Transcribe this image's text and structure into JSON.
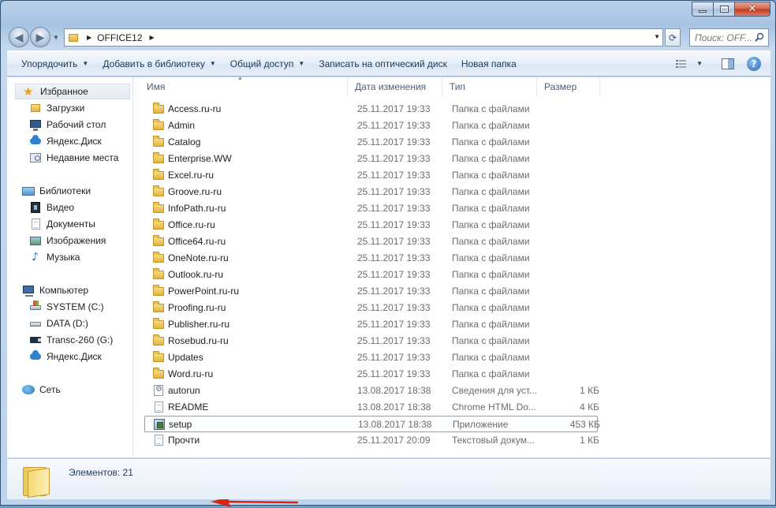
{
  "window": {
    "caption": {
      "minimize": "",
      "maximize": "",
      "close": "✕"
    }
  },
  "address": {
    "path": "OFFICE12",
    "search_placeholder": "Поиск: OFF..."
  },
  "toolbar": {
    "organize": "Упорядочить",
    "add_to_library": "Добавить в библиотеку",
    "share": "Общий доступ",
    "burn": "Записать на оптический диск",
    "new_folder": "Новая папка",
    "help": "?"
  },
  "sidebar": {
    "favorites": {
      "label": "Избранное",
      "items": [
        "Загрузки",
        "Рабочий стол",
        "Яндекс.Диск",
        "Недавние места"
      ]
    },
    "libraries": {
      "label": "Библиотеки",
      "items": [
        "Видео",
        "Документы",
        "Изображения",
        "Музыка"
      ]
    },
    "computer": {
      "label": "Компьютер",
      "items": [
        "SYSTEM (C:)",
        "DATA (D:)",
        "Transc-260 (G:)",
        "Яндекс.Диск"
      ]
    },
    "network": {
      "label": "Сеть"
    }
  },
  "columns": {
    "name": "Имя",
    "date": "Дата изменения",
    "type": "Тип",
    "size": "Размер"
  },
  "files": [
    {
      "name": "Access.ru-ru",
      "date": "25.11.2017 19:33",
      "type": "Папка с файлами",
      "size": "",
      "icon": "folder-icon"
    },
    {
      "name": "Admin",
      "date": "25.11.2017 19:33",
      "type": "Папка с файлами",
      "size": "",
      "icon": "folder-icon"
    },
    {
      "name": "Catalog",
      "date": "25.11.2017 19:33",
      "type": "Папка с файлами",
      "size": "",
      "icon": "folder-icon"
    },
    {
      "name": "Enterprise.WW",
      "date": "25.11.2017 19:33",
      "type": "Папка с файлами",
      "size": "",
      "icon": "folder-icon"
    },
    {
      "name": "Excel.ru-ru",
      "date": "25.11.2017 19:33",
      "type": "Папка с файлами",
      "size": "",
      "icon": "folder-icon"
    },
    {
      "name": "Groove.ru-ru",
      "date": "25.11.2017 19:33",
      "type": "Папка с файлами",
      "size": "",
      "icon": "folder-icon"
    },
    {
      "name": "InfoPath.ru-ru",
      "date": "25.11.2017 19:33",
      "type": "Папка с файлами",
      "size": "",
      "icon": "folder-icon"
    },
    {
      "name": "Office.ru-ru",
      "date": "25.11.2017 19:33",
      "type": "Папка с файлами",
      "size": "",
      "icon": "folder-icon"
    },
    {
      "name": "Office64.ru-ru",
      "date": "25.11.2017 19:33",
      "type": "Папка с файлами",
      "size": "",
      "icon": "folder-icon"
    },
    {
      "name": "OneNote.ru-ru",
      "date": "25.11.2017 19:33",
      "type": "Папка с файлами",
      "size": "",
      "icon": "folder-icon"
    },
    {
      "name": "Outlook.ru-ru",
      "date": "25.11.2017 19:33",
      "type": "Папка с файлами",
      "size": "",
      "icon": "folder-icon"
    },
    {
      "name": "PowerPoint.ru-ru",
      "date": "25.11.2017 19:33",
      "type": "Папка с файлами",
      "size": "",
      "icon": "folder-icon"
    },
    {
      "name": "Proofing.ru-ru",
      "date": "25.11.2017 19:33",
      "type": "Папка с файлами",
      "size": "",
      "icon": "folder-icon"
    },
    {
      "name": "Publisher.ru-ru",
      "date": "25.11.2017 19:33",
      "type": "Папка с файлами",
      "size": "",
      "icon": "folder-icon"
    },
    {
      "name": "Rosebud.ru-ru",
      "date": "25.11.2017 19:33",
      "type": "Папка с файлами",
      "size": "",
      "icon": "folder-icon"
    },
    {
      "name": "Updates",
      "date": "25.11.2017 19:33",
      "type": "Папка с файлами",
      "size": "",
      "icon": "folder-icon"
    },
    {
      "name": "Word.ru-ru",
      "date": "25.11.2017 19:33",
      "type": "Папка с файлами",
      "size": "",
      "icon": "folder-icon"
    },
    {
      "name": "autorun",
      "date": "13.08.2017 18:38",
      "type": "Сведения для уст...",
      "size": "1 КБ",
      "icon": "setup-info-icon"
    },
    {
      "name": "README",
      "date": "13.08.2017 18:38",
      "type": "Chrome HTML Do...",
      "size": "4 КБ",
      "icon": "document-icon"
    },
    {
      "name": "setup",
      "date": "13.08.2017 18:38",
      "type": "Приложение",
      "size": "453 КБ",
      "icon": "application-icon",
      "selected": true
    },
    {
      "name": "Прочти",
      "date": "25.11.2017 20:09",
      "type": "Текстовый докум...",
      "size": "1 КБ",
      "icon": "document-icon"
    }
  ],
  "status": {
    "items_count": "Элементов: 21"
  },
  "colors": {
    "frame": "#b9d1ea",
    "selection_border": "#7da2ce",
    "annotation_arrow": "#d9231b"
  }
}
